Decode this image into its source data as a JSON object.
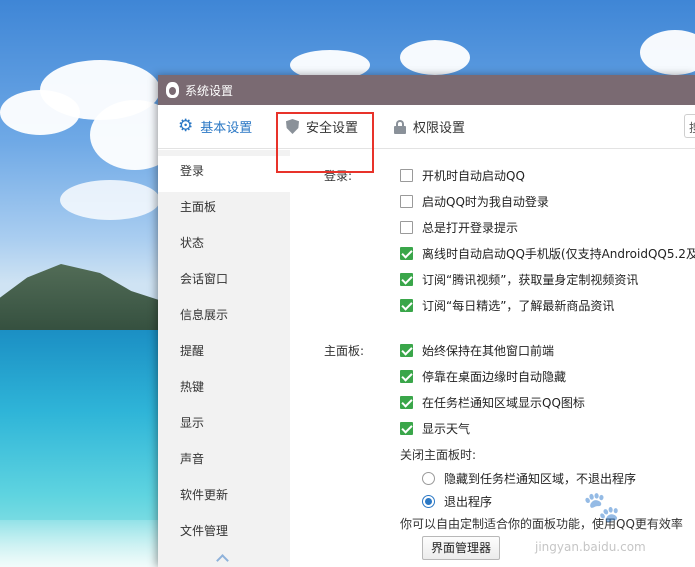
{
  "window": {
    "title": "系统设置"
  },
  "tabs": {
    "basic": "基本设置",
    "security": "安全设置",
    "permission": "权限设置",
    "search_partial": "搜"
  },
  "sidebar": {
    "items": [
      {
        "label": "登录",
        "active": true
      },
      {
        "label": "主面板"
      },
      {
        "label": "状态"
      },
      {
        "label": "会话窗口"
      },
      {
        "label": "信息展示"
      },
      {
        "label": "提醒"
      },
      {
        "label": "热键"
      },
      {
        "label": "显示"
      },
      {
        "label": "声音"
      },
      {
        "label": "软件更新"
      },
      {
        "label": "文件管理"
      }
    ]
  },
  "login": {
    "section_label": "登录:",
    "options": [
      {
        "label": "开机时自动启动QQ",
        "checked": false
      },
      {
        "label": "启动QQ时为我自动登录",
        "checked": false
      },
      {
        "label": "总是打开登录提示",
        "checked": false
      },
      {
        "label": "离线时自动启动QQ手机版(仅支持AndroidQQ5.2及",
        "checked": true
      },
      {
        "label": "订阅“腾讯视频”，获取量身定制视频资讯",
        "checked": true
      },
      {
        "label": "订阅“每日精选”，了解最新商品资讯",
        "checked": true
      }
    ]
  },
  "mainpanel": {
    "section_label": "主面板:",
    "options": [
      {
        "label": "始终保持在其他窗口前端",
        "checked": true
      },
      {
        "label": "停靠在桌面边缘时自动隐藏",
        "checked": true
      },
      {
        "label": "在任务栏通知区域显示QQ图标",
        "checked": true
      },
      {
        "label": "显示天气",
        "checked": true
      }
    ],
    "close_label": "关闭主面板时:",
    "close_options": [
      {
        "label": "隐藏到任务栏通知区域，不退出程序",
        "selected": false
      },
      {
        "label": "退出程序",
        "selected": true
      }
    ],
    "customize_text": "你可以自由定制适合你的面板功能，使用QQ更有效率",
    "manager_button": "界面管理器"
  },
  "watermark": {
    "text": "jingyan.baidu.com"
  },
  "colors": {
    "titlebar": "#7a6a72",
    "accent": "#2b78c5",
    "check": "#3aa64a",
    "highlight": "#e8332a"
  }
}
